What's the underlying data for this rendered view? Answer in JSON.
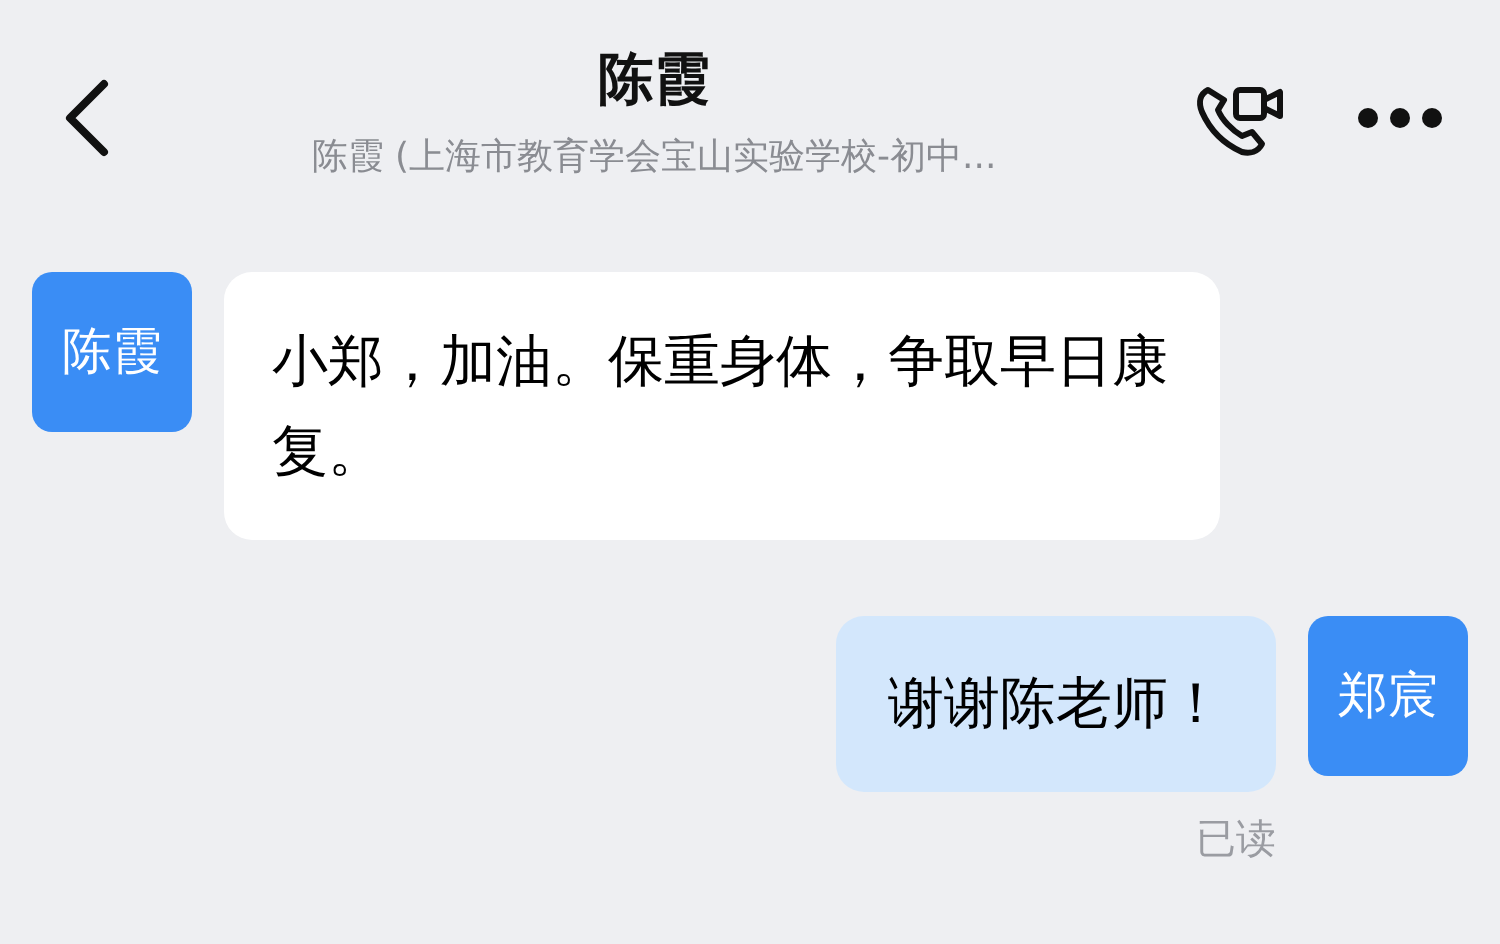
{
  "header": {
    "title": "陈霞",
    "subtitle": "陈霞 (上海市教育学会宝山实验学校-初中..."
  },
  "messages": [
    {
      "kind": "incoming",
      "avatar": "陈霞",
      "text": "小郑，加油。保重身体，争取早日康复。"
    },
    {
      "kind": "outgoing",
      "avatar": "郑宸",
      "text": "谢谢陈老师！",
      "status": "已读"
    }
  ]
}
